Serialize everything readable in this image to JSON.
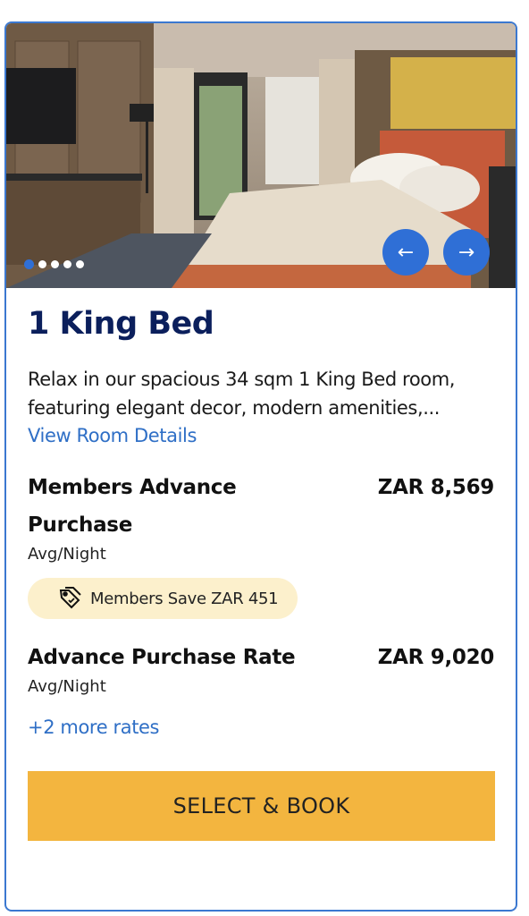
{
  "room": {
    "title": "1 King Bed",
    "description": "Relax in our spacious 34 sqm 1 King Bed room, featuring elegant decor, modern amenities,...",
    "details_link": "View Room Details"
  },
  "gallery": {
    "image_count": 5,
    "active_index": 0,
    "prev_icon": "←",
    "next_icon": "→"
  },
  "rates": [
    {
      "name": "Members Advance Purchase",
      "price": "ZAR 8,569",
      "unit": "Avg/Night",
      "badge": "Members Save ZAR 451"
    },
    {
      "name": "Advance Purchase Rate",
      "price": "ZAR 9,020",
      "unit": "Avg/Night"
    }
  ],
  "more_rates_link": "+2 more rates",
  "book_button": "SELECT & BOOK",
  "colors": {
    "accent": "#2f6fd6",
    "title": "#0b1f5c",
    "button": "#f3b53f",
    "badge_bg": "#fcf0cc"
  }
}
